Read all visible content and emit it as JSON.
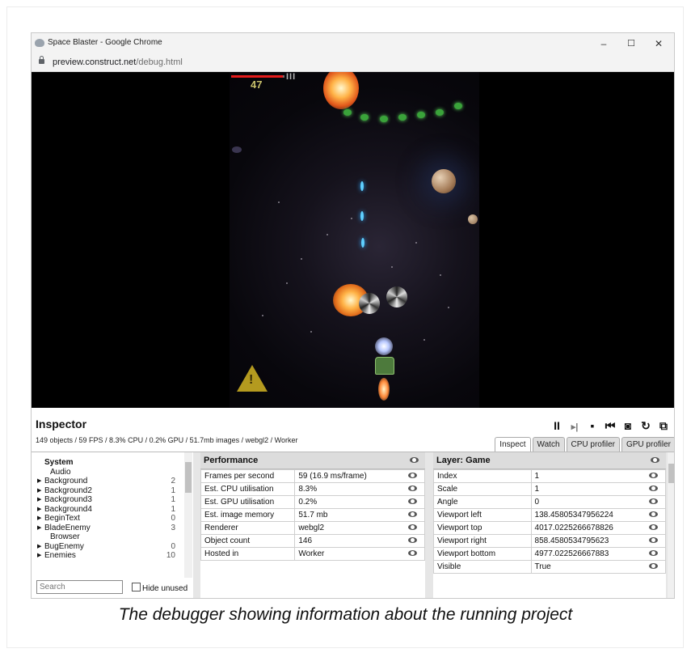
{
  "browser": {
    "title": "Space Blaster - Google Chrome",
    "url_host": "preview.construct.net",
    "url_path": "/debug.html",
    "minimize": "–",
    "maximize": "☐",
    "close": "✕"
  },
  "game": {
    "score": "47",
    "ammo": "III",
    "warning": "!"
  },
  "inspector": {
    "title": "Inspector",
    "stats": "149 objects / 59 FPS / 8.3% CPU / 0.2% GPU / 51.7mb images / webgl2 / Worker",
    "toolbar": {
      "pause": "II",
      "step": "▸|",
      "save": "▪",
      "load": "⏮",
      "screenshot": "◙",
      "restart": "↻",
      "popout": "⧉"
    },
    "tabs": [
      "Inspect",
      "Watch",
      "CPU profiler",
      "GPU profiler"
    ],
    "tree": [
      {
        "label": "System",
        "count": "",
        "kind": "bold"
      },
      {
        "label": "Audio",
        "count": "",
        "kind": "plain"
      },
      {
        "label": "Background",
        "count": "2",
        "kind": "exp"
      },
      {
        "label": "Background2",
        "count": "1",
        "kind": "exp"
      },
      {
        "label": "Background3",
        "count": "1",
        "kind": "exp"
      },
      {
        "label": "Background4",
        "count": "1",
        "kind": "exp"
      },
      {
        "label": "BeginText",
        "count": "0",
        "kind": "exp"
      },
      {
        "label": "BladeEnemy",
        "count": "3",
        "kind": "exp"
      },
      {
        "label": "Browser",
        "count": "",
        "kind": "plain"
      },
      {
        "label": "BugEnemy",
        "count": "0",
        "kind": "exp"
      },
      {
        "label": "Enemies",
        "count": "10",
        "kind": "exp"
      }
    ],
    "search_placeholder": "Search",
    "hide_unused": "Hide unused",
    "performance": {
      "header": "Performance",
      "rows": [
        [
          "Frames per second",
          "59 (16.9 ms/frame)"
        ],
        [
          "Est. CPU utilisation",
          "8.3%"
        ],
        [
          "Est. GPU utilisation",
          "0.2%"
        ],
        [
          "Est. image memory",
          "51.7 mb"
        ],
        [
          "Renderer",
          "webgl2"
        ],
        [
          "Object count",
          "146"
        ],
        [
          "Hosted in",
          "Worker"
        ]
      ]
    },
    "layer": {
      "header": "Layer: Game",
      "rows": [
        [
          "Index",
          "1"
        ],
        [
          "Scale",
          "1"
        ],
        [
          "Angle",
          "0"
        ],
        [
          "Viewport left",
          "138.45805347956224"
        ],
        [
          "Viewport top",
          "4017.0225266678826"
        ],
        [
          "Viewport right",
          "858.4580534795623"
        ],
        [
          "Viewport bottom",
          "4977.022526667883"
        ],
        [
          "Visible",
          "True"
        ]
      ]
    }
  },
  "caption": "The debugger showing information about the running project"
}
